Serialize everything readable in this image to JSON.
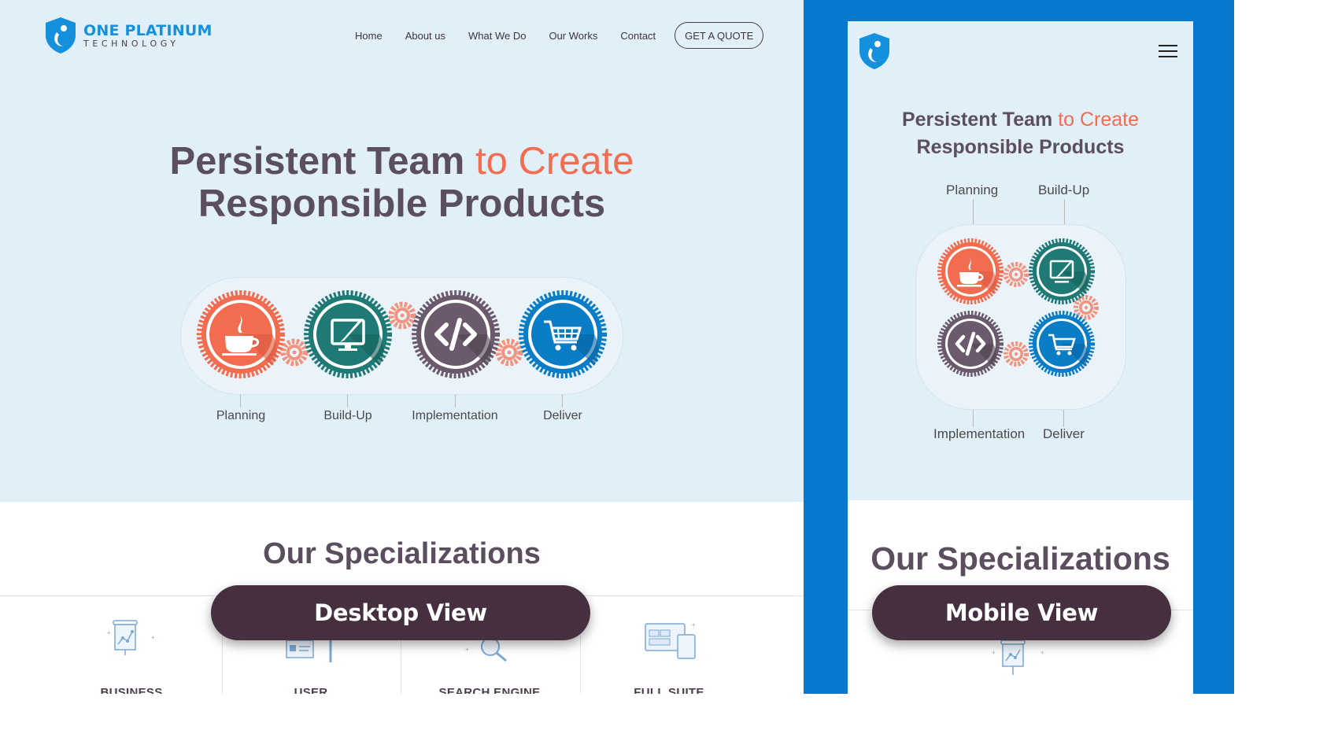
{
  "brand": {
    "name_top": "ONE PLATINUM",
    "name_bottom": "TECHNOLOGY",
    "colors": {
      "primary_blue": "#1590dd",
      "accent_orange": "#f26c4f",
      "dark_purple": "#5b4e5e",
      "pill_bg": "#46303f",
      "mobile_frame": "#0878cf"
    }
  },
  "nav": {
    "items": [
      "Home",
      "About us",
      "What We Do",
      "Our Works",
      "Contact"
    ],
    "cta": "GET A QUOTE"
  },
  "hero": {
    "title_part1": "Persistent Team",
    "title_accent": "to Create",
    "title_line2": "Responsible Products"
  },
  "process": {
    "steps": [
      {
        "label": "Planning",
        "icon": "coffee-cup-icon",
        "color": "#f26c4f"
      },
      {
        "label": "Build-Up",
        "icon": "monitor-pen-icon",
        "color": "#1f7a76"
      },
      {
        "label": "Implementation",
        "icon": "code-icon",
        "color": "#6a5a6c"
      },
      {
        "label": "Deliver",
        "icon": "shopping-cart-icon",
        "color": "#0b7cc6"
      }
    ]
  },
  "specializations": {
    "heading": "Our Specializations",
    "cards": [
      "BUSINESS",
      "USER",
      "SEARCH ENGINE",
      "FULL SUITE"
    ]
  },
  "labels": {
    "desktop": "Desktop View",
    "mobile": "Mobile View"
  }
}
